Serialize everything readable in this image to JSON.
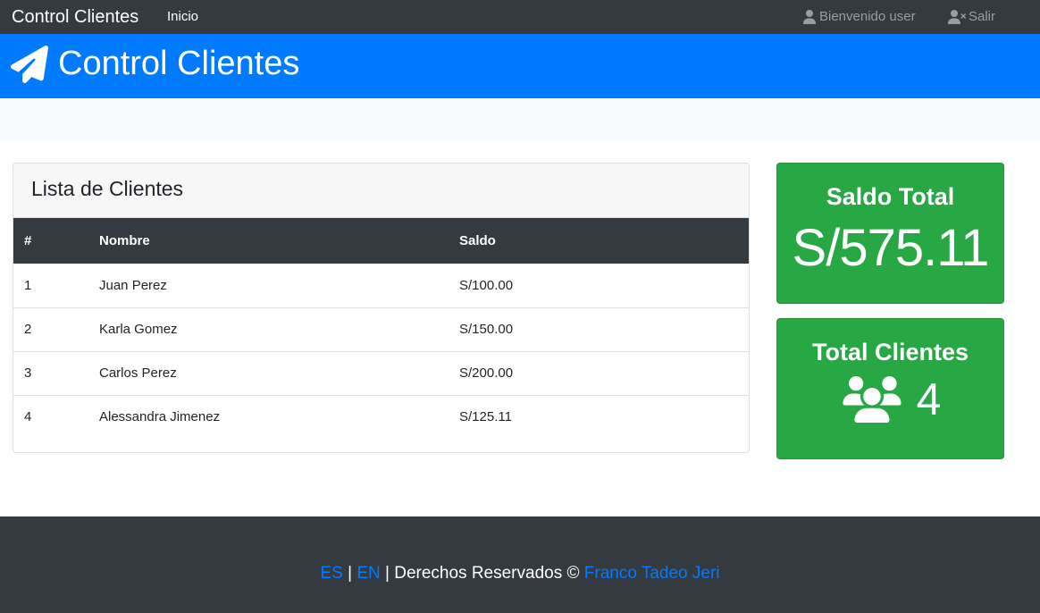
{
  "navbar": {
    "brand": "Control Clientes",
    "inicio": "Inicio",
    "welcome": "Bienvenido user",
    "logout": "Salir"
  },
  "hero": {
    "title": "Control Clientes"
  },
  "clientes": {
    "title": "Lista de Clientes",
    "columns": [
      "#",
      "Nombre",
      "Saldo"
    ],
    "rows": [
      {
        "id": "1",
        "nombre": "Juan Perez",
        "saldo": "S/100.00"
      },
      {
        "id": "2",
        "nombre": "Karla Gomez",
        "saldo": "S/150.00"
      },
      {
        "id": "3",
        "nombre": "Carlos Perez",
        "saldo": "S/200.00"
      },
      {
        "id": "4",
        "nombre": "Alessandra Jimenez",
        "saldo": "S/125.11"
      }
    ]
  },
  "stats": {
    "saldo_title": "Saldo Total",
    "saldo_value": "S/575.11",
    "clientes_title": "Total Clientes",
    "clientes_value": "4"
  },
  "footer": {
    "lang_es": "ES",
    "sep1": "|",
    "lang_en": "EN",
    "rights": "| Derechos Reservados ©",
    "author": "Franco Tadeo Jeri"
  },
  "colors": {
    "navbar": "#343a40",
    "primary": "#007bff",
    "success": "#28a745"
  },
  "icons": {
    "hero": "paper-plane-icon",
    "welcome": "user-icon",
    "logout": "user-times-icon",
    "clientes": "users-icon"
  }
}
